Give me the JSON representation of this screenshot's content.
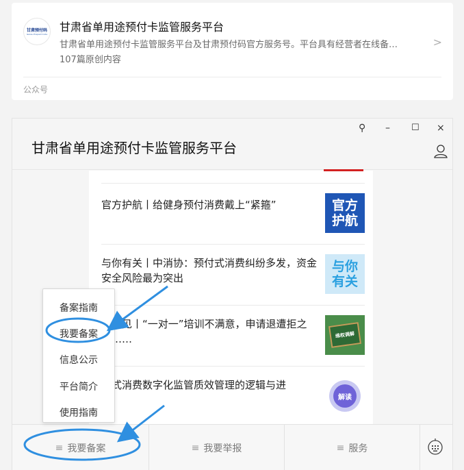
{
  "account": {
    "logo_line1": "甘肃预付码",
    "logo_line2": "Gansu Prepaid Code",
    "name": "甘肃省单用途预付卡监管服务平台",
    "description": "甘肃省单用途预付卡监管服务平台及甘肃预付码官方服务号。平台具有经营者在线备…",
    "article_count": "107篇原创内容",
    "footer_label": "公众号",
    "chevron": ">"
  },
  "window": {
    "title": "甘肃省单用途预付卡监管服务平台",
    "controls": {
      "pin": "⚲",
      "minimize": "–",
      "maximize": "☐",
      "close": "×"
    }
  },
  "articles": [
    {
      "title": "官方护航丨给健身预付消费戴上“紧箍”",
      "thumb_text": "官方\n护航"
    },
    {
      "title": "与你有关丨中消协：预付式消费纠纷多发，资金安全风险最为突出",
      "thumb_text": "与你\n有关"
    },
    {
      "title": "师意见丨“一对一”培训不满意，申请退遭拒之后……",
      "thumb_text": "维权调解"
    },
    {
      "title": "付式消费数字化监管质效管理的逻辑与进",
      "thumb_text": "解读"
    }
  ],
  "popup_menu": {
    "items": [
      "备案指南",
      "我要备案",
      "信息公示",
      "平台简介",
      "使用指南"
    ]
  },
  "menubar": {
    "tabs": [
      {
        "label": "我要备案",
        "icon": "≡"
      },
      {
        "label": "我要举报",
        "icon": "≡"
      },
      {
        "label": "服务",
        "icon": "≡"
      }
    ],
    "keyboard_icon": "keyboard-icon"
  },
  "colors": {
    "annotation_blue": "#2f8fe0",
    "accent_red": "#d32121"
  }
}
